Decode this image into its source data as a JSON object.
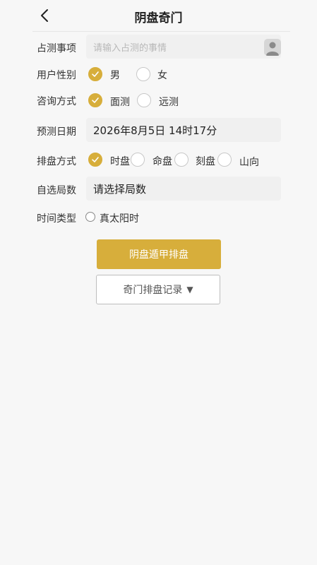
{
  "header": {
    "title": "阴盘奇门",
    "back_icon": "chevron-left-icon"
  },
  "form": {
    "matter": {
      "label": "占测事项",
      "placeholder": "请输入占测的事情",
      "contact_icon": "person-icon"
    },
    "gender": {
      "label": "用户性别",
      "options": [
        "男",
        "女"
      ],
      "selected": "男"
    },
    "consult": {
      "label": "咨询方式",
      "options": [
        "面测",
        "远测"
      ],
      "selected": "面测"
    },
    "date": {
      "label": "预测日期",
      "value": "2026年8月5日 14时17分"
    },
    "chart_method": {
      "label": "排盘方式",
      "options": [
        "时盘",
        "命盘",
        "刻盘",
        "山向"
      ],
      "selected": "时盘"
    },
    "custom_ju": {
      "label": "自选局数",
      "value": "请选择局数"
    },
    "time_type": {
      "label": "时间类型",
      "option": "真太阳时",
      "checked": false
    }
  },
  "buttons": {
    "submit": "阴盘遁甲排盘",
    "records": "奇门排盘记录",
    "records_arrow": "▼"
  },
  "colors": {
    "accent": "#d7ae3b",
    "background": "#f7f7f7"
  }
}
